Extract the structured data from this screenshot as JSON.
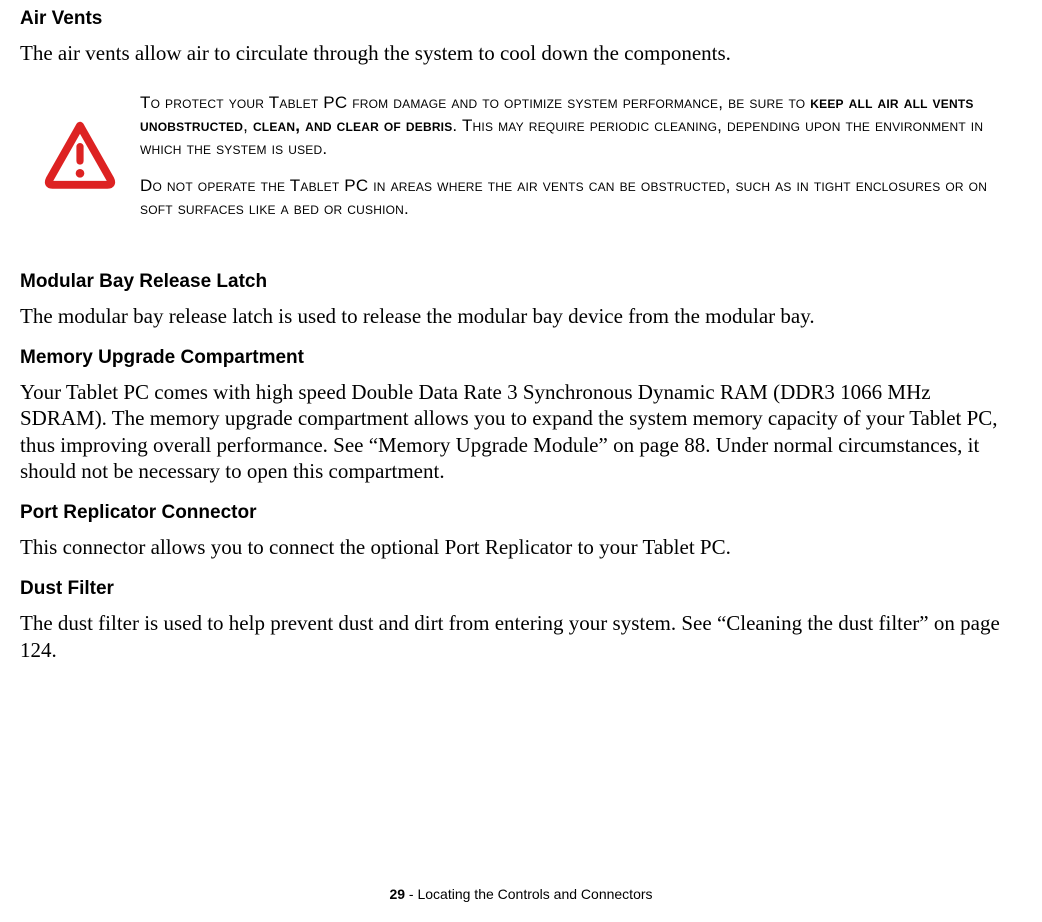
{
  "sections": {
    "air_vents": {
      "heading": "Air Vents",
      "body": "The air vents allow air to circulate through the system to cool down the components."
    },
    "warning": {
      "para1_pre": "To protect your Tablet PC from damage and to optimize system performance, be sure to ",
      "para1_bold": "keep all air all vents unobstructed",
      "para1_mid": ", ",
      "para1_bold2": "clean, and clear of debris",
      "para1_post": ". This may require periodic cleaning, depending upon the environment in which the system is used.",
      "para2": "Do not operate the Tablet PC in areas where the air vents can be obstructed, such as in tight enclosures or on soft surfaces like a bed or cushion."
    },
    "modular_bay": {
      "heading": "Modular Bay Release Latch",
      "body": "The modular bay release latch is used to release the modular bay device from the modular bay."
    },
    "memory": {
      "heading": "Memory Upgrade Compartment",
      "body": "Your Tablet PC comes with high speed Double Data Rate 3 Synchronous Dynamic RAM (DDR3 1066 MHz SDRAM). The memory upgrade compartment allows you to expand the system memory capacity of your Tablet PC, thus improving overall performance. See “Memory Upgrade Module” on page 88. Under normal circumstances, it should not be necessary to open this compartment."
    },
    "port_replicator": {
      "heading": "Port Replicator Connector",
      "body": "This connector allows you to connect the optional Port Replicator to your Tablet PC."
    },
    "dust_filter": {
      "heading": "Dust Filter",
      "body": "The dust filter is used to help prevent dust and dirt from entering your system. See “Cleaning the dust filter” on page 124."
    }
  },
  "footer": {
    "page_num": "29",
    "separator": " - ",
    "title": "Locating the Controls and Connectors"
  }
}
